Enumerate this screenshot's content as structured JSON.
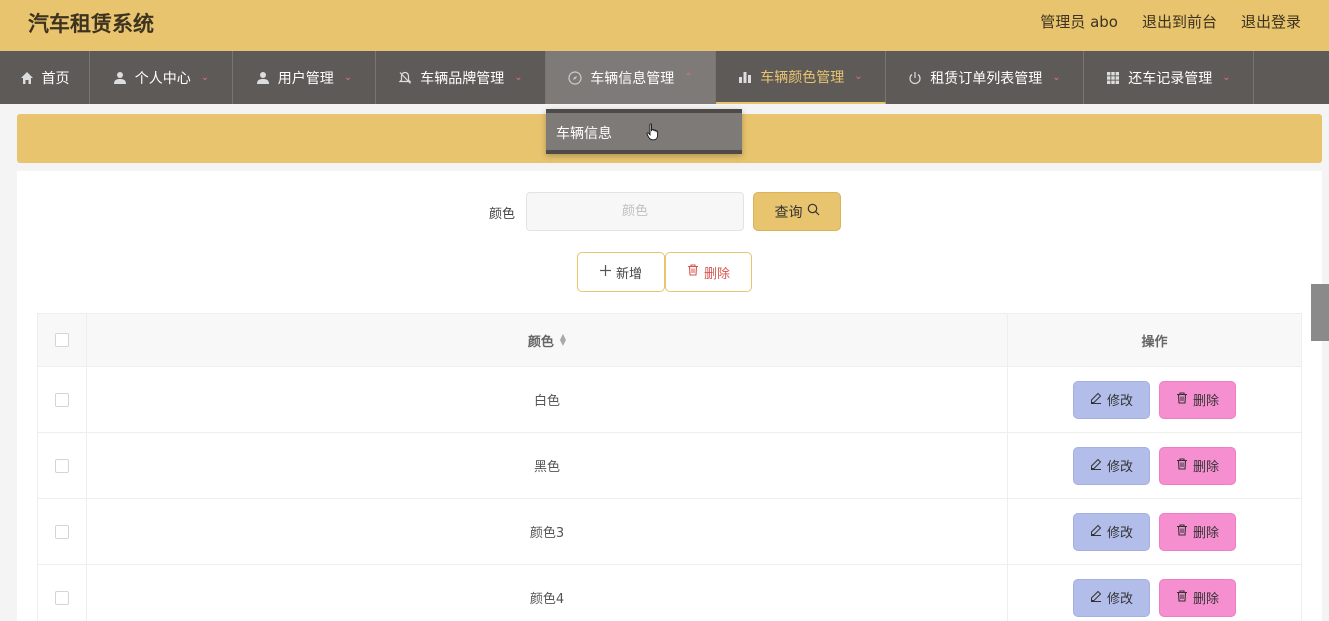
{
  "header": {
    "title": "汽车租赁系统",
    "user": "管理员 abo",
    "to_front": "退出到前台",
    "logout": "退出登录"
  },
  "nav": {
    "home": "首页",
    "personal": "个人中心",
    "users": "用户管理",
    "brand": "车辆品牌管理",
    "vehicle_info": "车辆信息管理",
    "vehicle_color": "车辆颜色管理",
    "orders": "租赁订单列表管理",
    "returns": "还车记录管理"
  },
  "dropdown": {
    "item": "车辆信息"
  },
  "search": {
    "label": "颜色",
    "placeholder": "颜色",
    "query_label": "查询"
  },
  "actions": {
    "add_label": "新增",
    "delete_label": "删除"
  },
  "table": {
    "headers": {
      "color": "颜色",
      "operation": "操作"
    },
    "rows": [
      {
        "color": "白色"
      },
      {
        "color": "黑色"
      },
      {
        "color": "颜色3"
      },
      {
        "color": "颜色4"
      }
    ],
    "edit_label": "修改",
    "remove_label": "删除"
  },
  "colors": {
    "accent": "#e8c46f",
    "nav_bg": "#5e5a58",
    "edit_button": "#b3bde9",
    "remove_button": "#f58fd0"
  }
}
